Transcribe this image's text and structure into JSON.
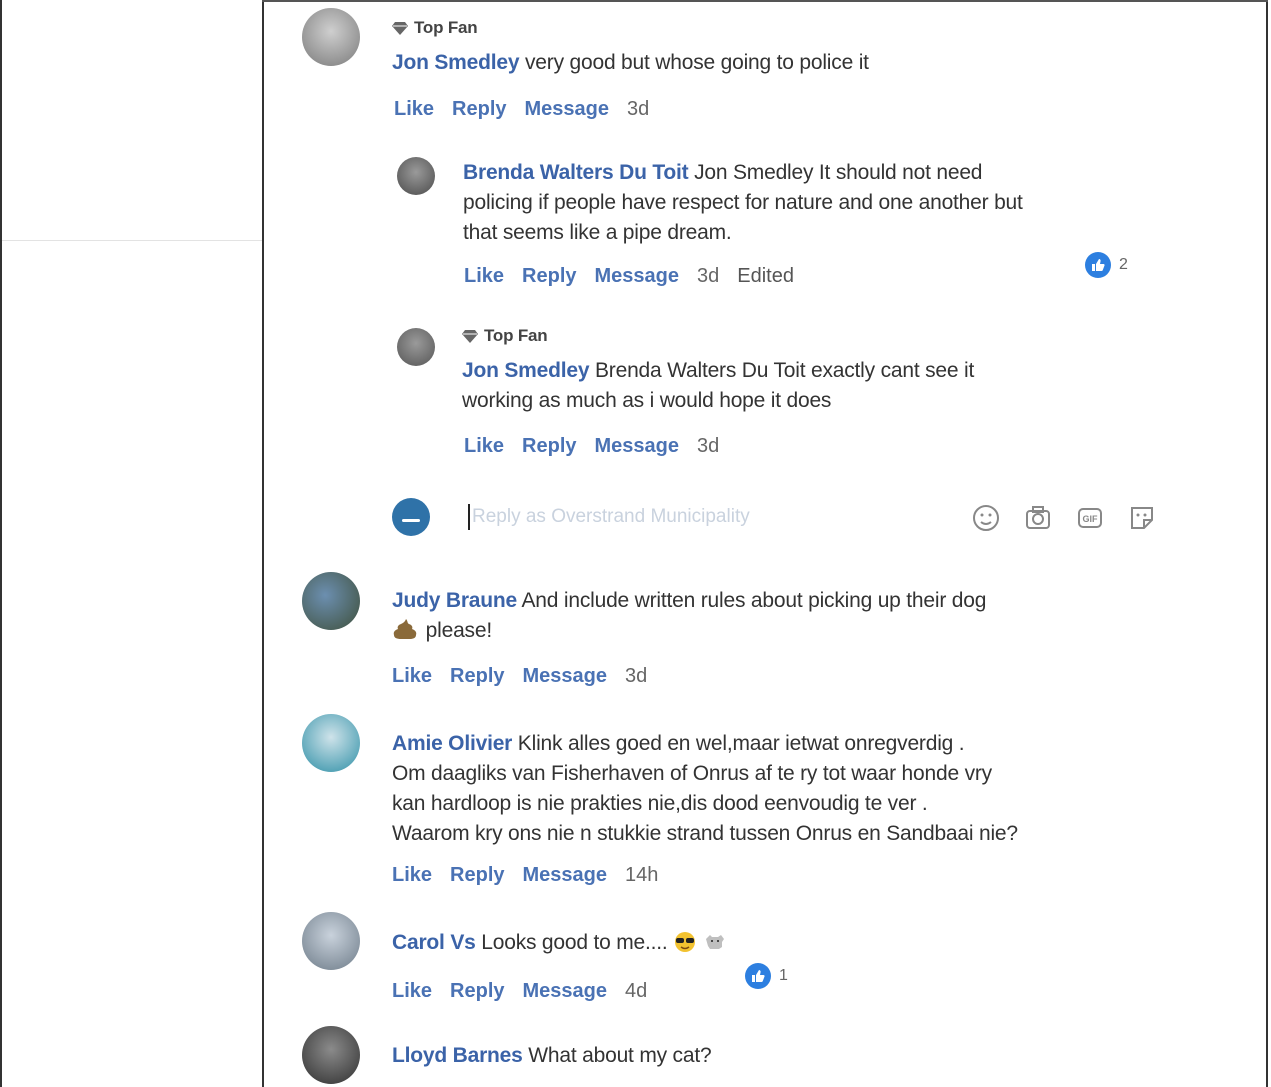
{
  "colors": {
    "name": "#3b63a8",
    "action": "#4a72b4",
    "like": "#2d7fe0"
  },
  "comments": [
    {
      "badge": "Top Fan",
      "name": "Jon Smedley",
      "text": "very good but whose going to police it",
      "actions": {
        "like": "Like",
        "reply": "Reply",
        "message": "Message",
        "time": "3d"
      }
    },
    {
      "name": "Brenda Walters Du Toit",
      "text_line1": "Jon Smedley It should not need",
      "text_line2": "policing if people have respect for nature and one another but",
      "text_line3": "that seems like a pipe dream.",
      "actions": {
        "like": "Like",
        "reply": "Reply",
        "message": "Message",
        "time": "3d",
        "edited": "Edited"
      },
      "reaction_count": "2"
    },
    {
      "badge": "Top Fan",
      "name": "Jon Smedley",
      "text_line1": "Brenda Walters Du Toit exactly cant see it",
      "text_line2": "working as much as i would hope it does",
      "actions": {
        "like": "Like",
        "reply": "Reply",
        "message": "Message",
        "time": "3d"
      }
    },
    {
      "name": "Judy Braune",
      "text_line1": "And include written rules about picking up their dog",
      "text_line2": "please!",
      "actions": {
        "like": "Like",
        "reply": "Reply",
        "message": "Message",
        "time": "3d"
      }
    },
    {
      "name": "Amie Olivier",
      "text_line1": "Klink alles goed en wel,maar ietwat onregverdig .",
      "text_line2": "Om daagliks van Fisherhaven of Onrus af te ry tot waar honde vry",
      "text_line3": "kan hardloop is nie prakties nie,dis dood eenvoudig te ver .",
      "text_line4": "Waarom kry ons nie n stukkie strand tussen Onrus en Sandbaai nie?",
      "actions": {
        "like": "Like",
        "reply": "Reply",
        "message": "Message",
        "time": "14h"
      }
    },
    {
      "name": "Carol Vs",
      "text": "Looks good to me....",
      "actions": {
        "like": "Like",
        "reply": "Reply",
        "message": "Message",
        "time": "4d"
      },
      "reaction_count": "1"
    },
    {
      "name": "Lloyd Barnes",
      "text": "What about my cat?"
    }
  ],
  "reply_box": {
    "placeholder": "Reply as Overstrand Municipality"
  },
  "icons": [
    "gem-icon",
    "like-icon",
    "emoji-icon",
    "camera-icon",
    "gif-icon",
    "sticker-icon",
    "poop-emoji-icon",
    "sunglasses-emoji-icon",
    "dog-emoji-icon"
  ]
}
